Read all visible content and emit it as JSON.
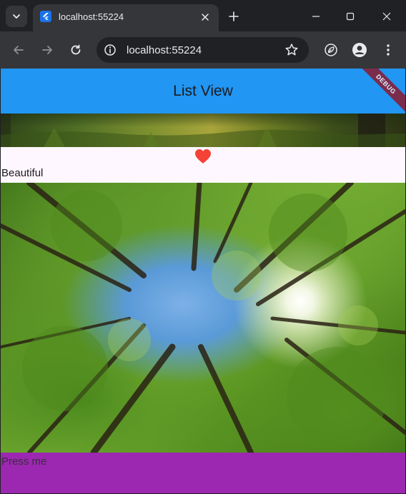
{
  "browser": {
    "tab": {
      "title": "localhost:55224"
    },
    "omnibox": {
      "url": "localhost:55224"
    }
  },
  "app": {
    "appbar": {
      "title": "List View",
      "color": "#2196f3"
    },
    "debug_banner": "DEBUG",
    "list": {
      "heart_color": "#f44336",
      "caption": "Beautiful"
    },
    "button": {
      "label": "Press me",
      "color": "#9c27b0"
    }
  }
}
